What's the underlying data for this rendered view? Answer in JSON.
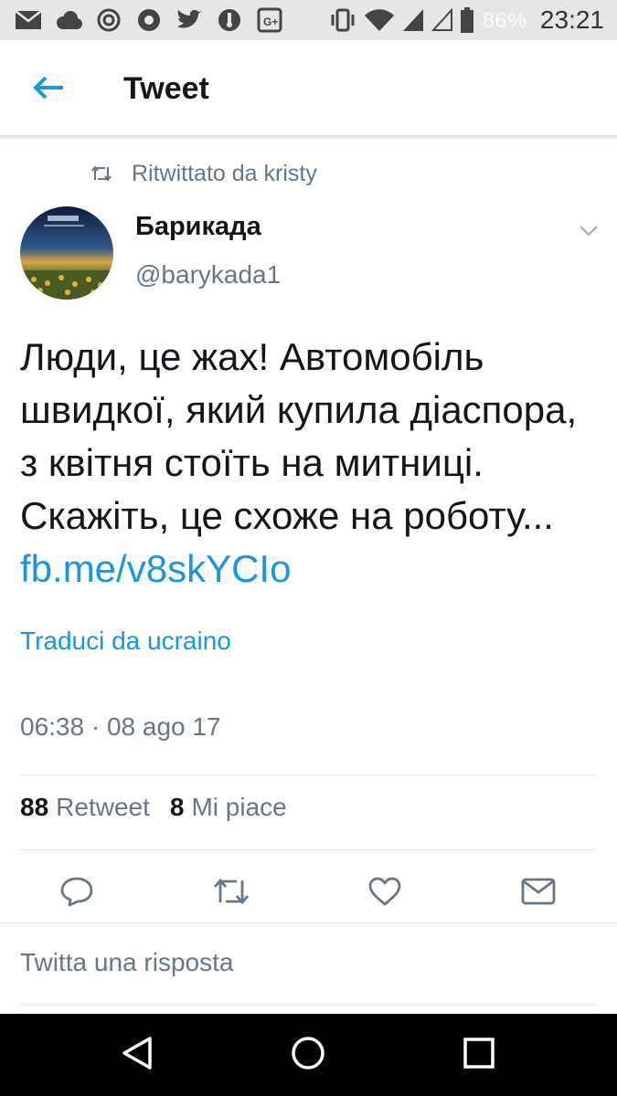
{
  "status_bar": {
    "battery_percent": "86%",
    "time": "23:21",
    "left_icons": [
      "mail-icon",
      "cloud-icon",
      "spiral-icon",
      "chrome-icon",
      "twitter-icon",
      "thermometer-icon",
      "google-plus-icon"
    ],
    "right_icons": [
      "vibrate-icon",
      "wifi-icon",
      "signal-icon",
      "signal-empty-icon",
      "battery-icon"
    ]
  },
  "header": {
    "title": "Tweet"
  },
  "tweet": {
    "retweeted_by": "Ritwittato da kristy",
    "author_name": "Барикада",
    "author_handle": "@barykada1",
    "text": "Люди, це жах! Автомобіль швидкої, який купила діаспора, з квітня стоїть на митниці. Скажіть, це схоже на роботу...",
    "link": "fb.me/v8skYCIo",
    "translate_label": "Traduci da ucraino",
    "timestamp": "06:38 · 08 ago 17",
    "retweet_count": "88",
    "retweet_label": "Retweet",
    "like_count": "8",
    "like_label": "Mi piace"
  },
  "reply": {
    "placeholder": "Twitta una risposta"
  },
  "colors": {
    "accent": "#1b95e0",
    "muted": "#657786",
    "text": "#14171a"
  }
}
